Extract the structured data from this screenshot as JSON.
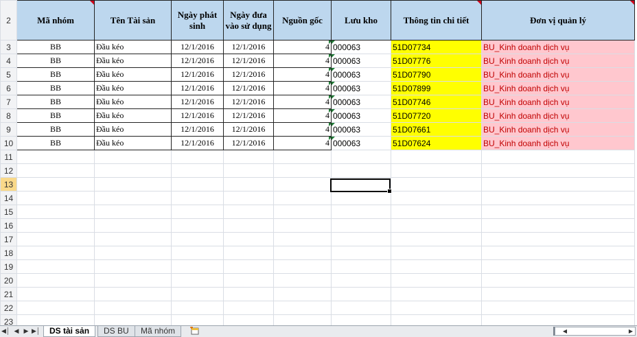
{
  "sheet": {
    "header_row_number": "2",
    "columns": [
      "Mã nhóm",
      "Tên Tài sản",
      "Ngày phát sinh",
      "Ngày đưa vào sử dụng",
      "Nguồn gốc",
      "Lưu kho",
      "Thông tin chi tiết",
      "Đơn vị quản lý"
    ],
    "rows": [
      {
        "num": "3",
        "group": "BB",
        "name": "Đầu kéo",
        "date1": "12/1/2016",
        "date2": "12/1/2016",
        "origin": "4",
        "store": "000063",
        "detail": "51D07734",
        "unit": "BU_Kinh doanh dịch vụ"
      },
      {
        "num": "4",
        "group": "BB",
        "name": "Đầu kéo",
        "date1": "12/1/2016",
        "date2": "12/1/2016",
        "origin": "4",
        "store": "000063",
        "detail": "51D07776",
        "unit": "BU_Kinh doanh dịch vụ"
      },
      {
        "num": "5",
        "group": "BB",
        "name": "Đầu kéo",
        "date1": "12/1/2016",
        "date2": "12/1/2016",
        "origin": "4",
        "store": "000063",
        "detail": "51D07790",
        "unit": "BU_Kinh doanh dịch vụ"
      },
      {
        "num": "6",
        "group": "BB",
        "name": "Đầu kéo",
        "date1": "12/1/2016",
        "date2": "12/1/2016",
        "origin": "4",
        "store": "000063",
        "detail": "51D07899",
        "unit": "BU_Kinh doanh dịch vụ"
      },
      {
        "num": "7",
        "group": "BB",
        "name": "Đầu kéo",
        "date1": "12/1/2016",
        "date2": "12/1/2016",
        "origin": "4",
        "store": "000063",
        "detail": "51D07746",
        "unit": "BU_Kinh doanh dịch vụ"
      },
      {
        "num": "8",
        "group": "BB",
        "name": "Đầu kéo",
        "date1": "12/1/2016",
        "date2": "12/1/2016",
        "origin": "4",
        "store": "000063",
        "detail": "51D07720",
        "unit": "BU_Kinh doanh dịch vụ"
      },
      {
        "num": "9",
        "group": "BB",
        "name": "Đầu kéo",
        "date1": "12/1/2016",
        "date2": "12/1/2016",
        "origin": "4",
        "store": "000063",
        "detail": "51D07661",
        "unit": "BU_Kinh doanh dịch vụ"
      },
      {
        "num": "10",
        "group": "BB",
        "name": "Đầu kéo",
        "date1": "12/1/2016",
        "date2": "12/1/2016",
        "origin": "4",
        "store": "000063",
        "detail": "51D07624",
        "unit": "BU_Kinh doanh dịch vụ"
      }
    ],
    "empty_rows": [
      "11",
      "12",
      "13",
      "14",
      "15",
      "16",
      "17",
      "18",
      "19",
      "20",
      "21",
      "22",
      "23"
    ],
    "selected_row": "13"
  },
  "tabs": {
    "items": [
      "DS tài sản",
      "DS BU",
      "Mã nhóm"
    ],
    "active_index": 0
  },
  "colors": {
    "header_fill": "#bdd7ee",
    "detail_fill": "#ffff00",
    "unit_fill": "#ffc7ce",
    "unit_text": "#c00000"
  }
}
